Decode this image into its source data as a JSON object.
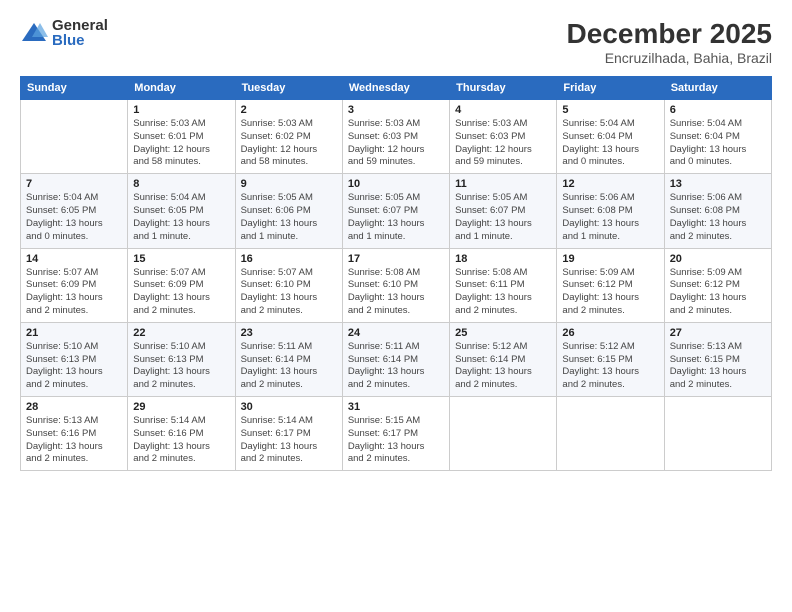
{
  "logo": {
    "general": "General",
    "blue": "Blue"
  },
  "header": {
    "month": "December 2025",
    "location": "Encruzilhada, Bahia, Brazil"
  },
  "weekdays": [
    "Sunday",
    "Monday",
    "Tuesday",
    "Wednesday",
    "Thursday",
    "Friday",
    "Saturday"
  ],
  "weeks": [
    [
      {
        "day": "",
        "info": ""
      },
      {
        "day": "1",
        "info": "Sunrise: 5:03 AM\nSunset: 6:01 PM\nDaylight: 12 hours\nand 58 minutes."
      },
      {
        "day": "2",
        "info": "Sunrise: 5:03 AM\nSunset: 6:02 PM\nDaylight: 12 hours\nand 58 minutes."
      },
      {
        "day": "3",
        "info": "Sunrise: 5:03 AM\nSunset: 6:03 PM\nDaylight: 12 hours\nand 59 minutes."
      },
      {
        "day": "4",
        "info": "Sunrise: 5:03 AM\nSunset: 6:03 PM\nDaylight: 12 hours\nand 59 minutes."
      },
      {
        "day": "5",
        "info": "Sunrise: 5:04 AM\nSunset: 6:04 PM\nDaylight: 13 hours\nand 0 minutes."
      },
      {
        "day": "6",
        "info": "Sunrise: 5:04 AM\nSunset: 6:04 PM\nDaylight: 13 hours\nand 0 minutes."
      }
    ],
    [
      {
        "day": "7",
        "info": "Sunrise: 5:04 AM\nSunset: 6:05 PM\nDaylight: 13 hours\nand 0 minutes."
      },
      {
        "day": "8",
        "info": "Sunrise: 5:04 AM\nSunset: 6:05 PM\nDaylight: 13 hours\nand 1 minute."
      },
      {
        "day": "9",
        "info": "Sunrise: 5:05 AM\nSunset: 6:06 PM\nDaylight: 13 hours\nand 1 minute."
      },
      {
        "day": "10",
        "info": "Sunrise: 5:05 AM\nSunset: 6:07 PM\nDaylight: 13 hours\nand 1 minute."
      },
      {
        "day": "11",
        "info": "Sunrise: 5:05 AM\nSunset: 6:07 PM\nDaylight: 13 hours\nand 1 minute."
      },
      {
        "day": "12",
        "info": "Sunrise: 5:06 AM\nSunset: 6:08 PM\nDaylight: 13 hours\nand 1 minute."
      },
      {
        "day": "13",
        "info": "Sunrise: 5:06 AM\nSunset: 6:08 PM\nDaylight: 13 hours\nand 2 minutes."
      }
    ],
    [
      {
        "day": "14",
        "info": "Sunrise: 5:07 AM\nSunset: 6:09 PM\nDaylight: 13 hours\nand 2 minutes."
      },
      {
        "day": "15",
        "info": "Sunrise: 5:07 AM\nSunset: 6:09 PM\nDaylight: 13 hours\nand 2 minutes."
      },
      {
        "day": "16",
        "info": "Sunrise: 5:07 AM\nSunset: 6:10 PM\nDaylight: 13 hours\nand 2 minutes."
      },
      {
        "day": "17",
        "info": "Sunrise: 5:08 AM\nSunset: 6:10 PM\nDaylight: 13 hours\nand 2 minutes."
      },
      {
        "day": "18",
        "info": "Sunrise: 5:08 AM\nSunset: 6:11 PM\nDaylight: 13 hours\nand 2 minutes."
      },
      {
        "day": "19",
        "info": "Sunrise: 5:09 AM\nSunset: 6:12 PM\nDaylight: 13 hours\nand 2 minutes."
      },
      {
        "day": "20",
        "info": "Sunrise: 5:09 AM\nSunset: 6:12 PM\nDaylight: 13 hours\nand 2 minutes."
      }
    ],
    [
      {
        "day": "21",
        "info": "Sunrise: 5:10 AM\nSunset: 6:13 PM\nDaylight: 13 hours\nand 2 minutes."
      },
      {
        "day": "22",
        "info": "Sunrise: 5:10 AM\nSunset: 6:13 PM\nDaylight: 13 hours\nand 2 minutes."
      },
      {
        "day": "23",
        "info": "Sunrise: 5:11 AM\nSunset: 6:14 PM\nDaylight: 13 hours\nand 2 minutes."
      },
      {
        "day": "24",
        "info": "Sunrise: 5:11 AM\nSunset: 6:14 PM\nDaylight: 13 hours\nand 2 minutes."
      },
      {
        "day": "25",
        "info": "Sunrise: 5:12 AM\nSunset: 6:14 PM\nDaylight: 13 hours\nand 2 minutes."
      },
      {
        "day": "26",
        "info": "Sunrise: 5:12 AM\nSunset: 6:15 PM\nDaylight: 13 hours\nand 2 minutes."
      },
      {
        "day": "27",
        "info": "Sunrise: 5:13 AM\nSunset: 6:15 PM\nDaylight: 13 hours\nand 2 minutes."
      }
    ],
    [
      {
        "day": "28",
        "info": "Sunrise: 5:13 AM\nSunset: 6:16 PM\nDaylight: 13 hours\nand 2 minutes."
      },
      {
        "day": "29",
        "info": "Sunrise: 5:14 AM\nSunset: 6:16 PM\nDaylight: 13 hours\nand 2 minutes."
      },
      {
        "day": "30",
        "info": "Sunrise: 5:14 AM\nSunset: 6:17 PM\nDaylight: 13 hours\nand 2 minutes."
      },
      {
        "day": "31",
        "info": "Sunrise: 5:15 AM\nSunset: 6:17 PM\nDaylight: 13 hours\nand 2 minutes."
      },
      {
        "day": "",
        "info": ""
      },
      {
        "day": "",
        "info": ""
      },
      {
        "day": "",
        "info": ""
      }
    ]
  ]
}
